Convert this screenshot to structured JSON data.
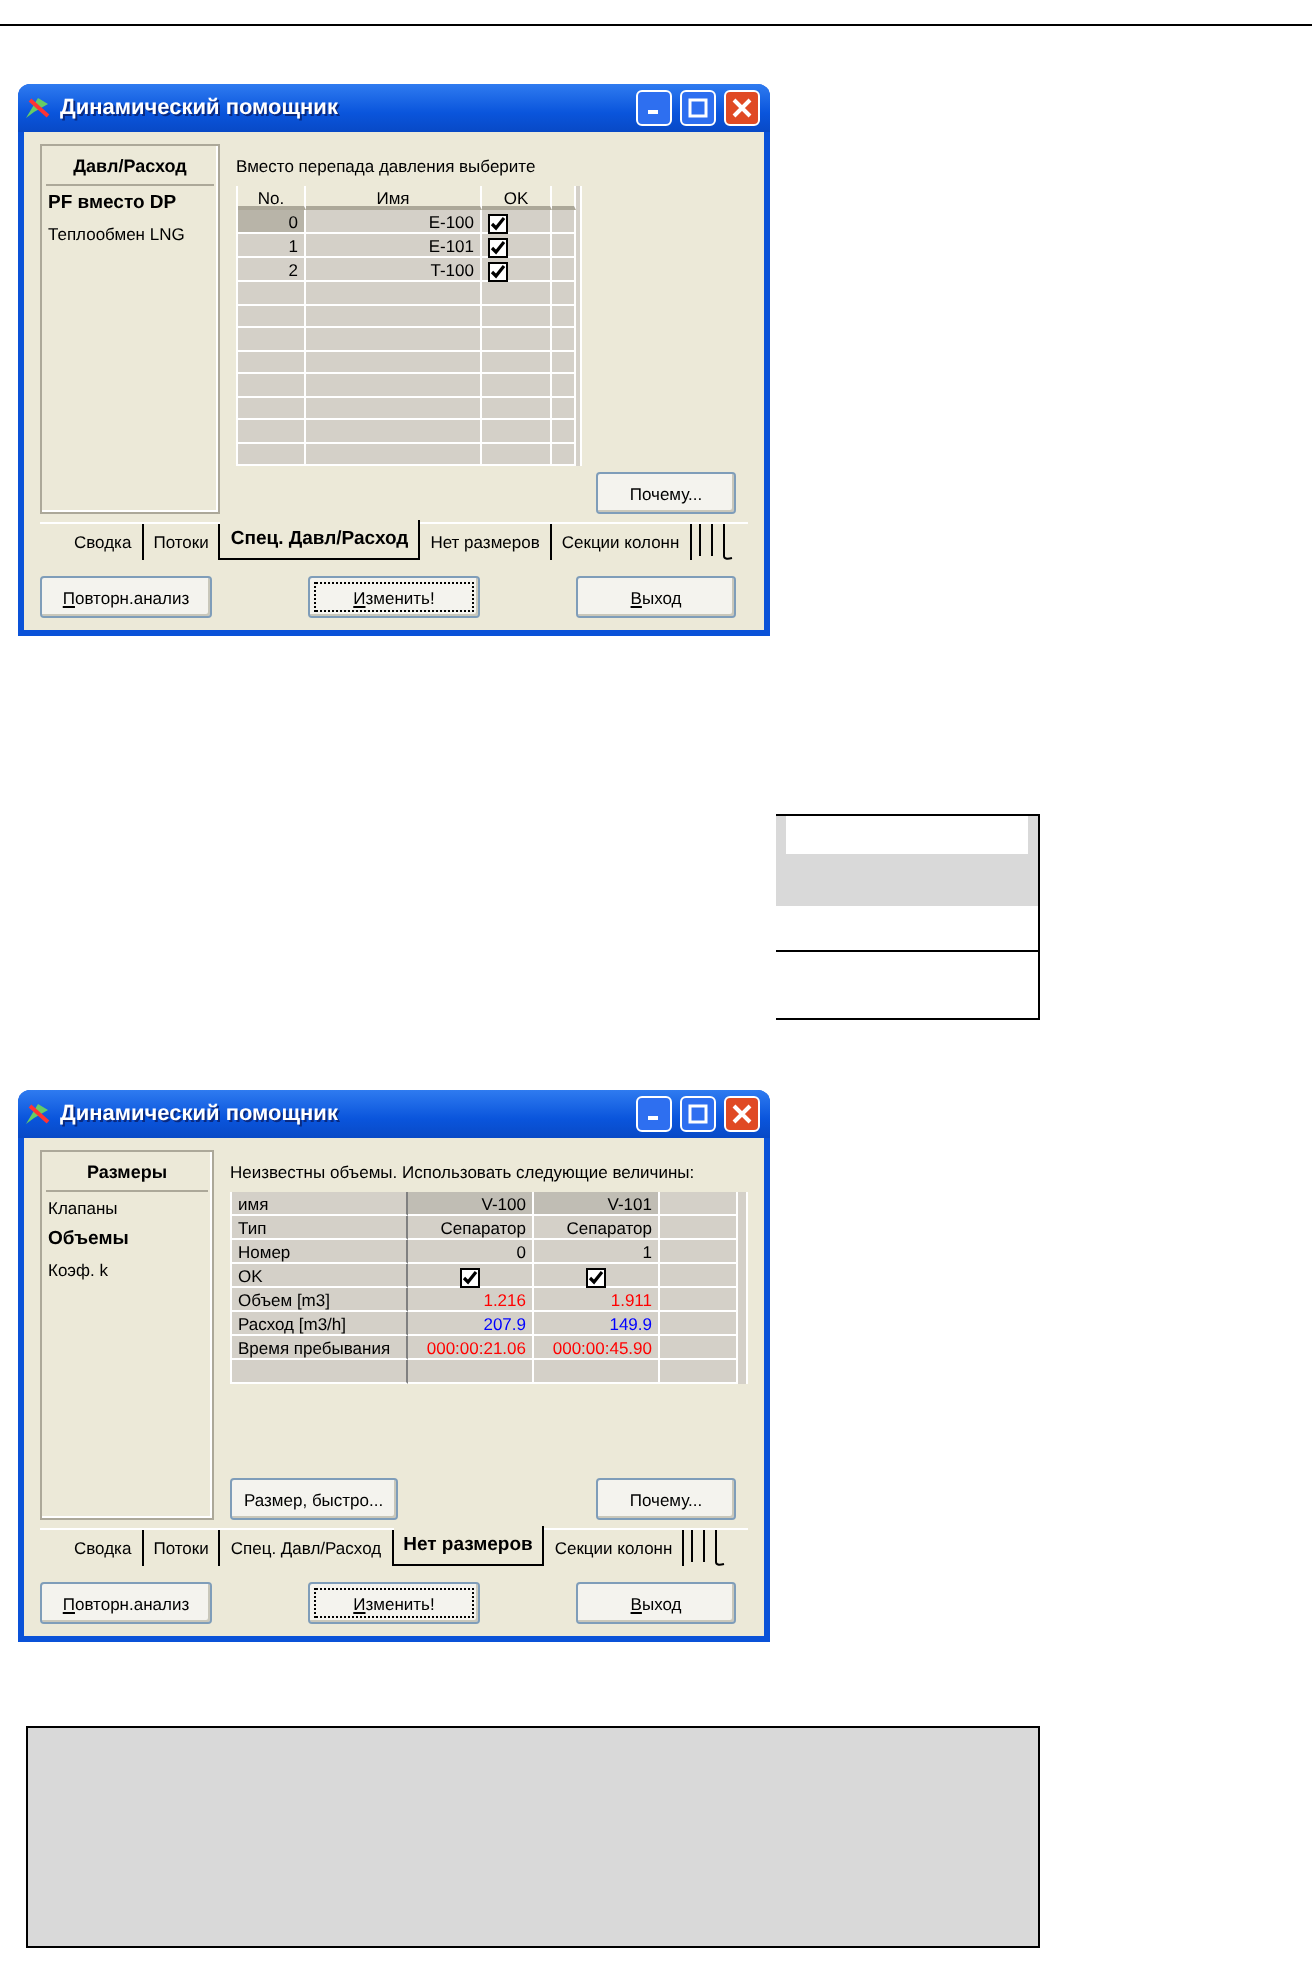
{
  "windows": [
    {
      "title": "Динамический помощник",
      "sidebar": {
        "heading": "Давл/Расход",
        "items": [
          {
            "label": "PF вместо DP",
            "selected": true
          },
          {
            "label": "Теплообмен LNG",
            "selected": false
          }
        ]
      },
      "prompt": "Вместо перепада давления выберите",
      "table": {
        "kind": "list",
        "columns": [
          "No.",
          "Имя",
          "OK"
        ],
        "rows": [
          {
            "no": "0",
            "name": "E-100",
            "checked": true,
            "selected": true
          },
          {
            "no": "1",
            "name": "E-101",
            "checked": true,
            "selected": false
          },
          {
            "no": "2",
            "name": "T-100",
            "checked": true,
            "selected": false
          }
        ]
      },
      "side_buttons": [
        "Почему..."
      ],
      "tabs": [
        {
          "label": "Сводка",
          "selected": false
        },
        {
          "label": "Потоки",
          "selected": false
        },
        {
          "label": "Спец. Давл/Расход",
          "selected": true
        },
        {
          "label": "Нет размеров",
          "selected": false
        },
        {
          "label": "Секции колонн",
          "selected": false
        }
      ],
      "buttons": [
        {
          "label": "Повторн.анализ",
          "focused": false
        },
        {
          "label": "Изменить!",
          "focused": true
        },
        {
          "label": "Выход",
          "focused": false
        }
      ]
    },
    {
      "title": "Динамический помощник",
      "sidebar": {
        "heading": "Размеры",
        "items": [
          {
            "label": "Клапаны",
            "selected": false
          },
          {
            "label": "Объемы",
            "selected": true
          },
          {
            "label": "Коэф. k",
            "selected": false
          }
        ]
      },
      "prompt": "Неизвестны объемы. Использовать следующие величины:",
      "table": {
        "kind": "grid",
        "rows": [
          {
            "kind": "header",
            "label": "имя",
            "values": [
              "V-100",
              "V-101"
            ]
          },
          {
            "kind": "text",
            "label": "Тип",
            "values": [
              "Сепаратор",
              "Сепаратор"
            ]
          },
          {
            "kind": "text",
            "label": "Номер",
            "values": [
              "0",
              "1"
            ]
          },
          {
            "kind": "checkbox",
            "label": "OK",
            "checked": [
              true,
              true
            ]
          },
          {
            "kind": "text",
            "label": "Объем [m3]",
            "values": [
              "1.216",
              "1.911"
            ],
            "color": "#ff0000"
          },
          {
            "kind": "text",
            "label": "Расход [m3/h]",
            "values": [
              "207.9",
              "149.9"
            ],
            "color": "#0000ff"
          },
          {
            "kind": "text",
            "label": "Время пребывания",
            "values": [
              "000:00:21.06",
              "000:00:45.90"
            ],
            "color": "#ff0000"
          }
        ]
      },
      "side_buttons": [
        "Размер, быстро...",
        "Почему..."
      ],
      "tabs": [
        {
          "label": "Сводка",
          "selected": false
        },
        {
          "label": "Потоки",
          "selected": false
        },
        {
          "label": "Спец. Давл/Расход",
          "selected": false
        },
        {
          "label": "Нет размеров",
          "selected": true
        },
        {
          "label": "Секции колонн",
          "selected": false
        }
      ],
      "buttons": [
        {
          "label": "Повторн.анализ",
          "focused": false
        },
        {
          "label": "Изменить!",
          "focused": true
        },
        {
          "label": "Выход",
          "focused": false
        }
      ]
    }
  ]
}
